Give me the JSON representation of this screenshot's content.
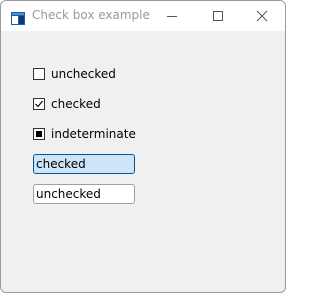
{
  "window": {
    "title": "Check box example",
    "colors": {
      "title_text": "#9a9a9a",
      "client_background": "#f0f0f0",
      "selected_textbox_background": "#cce4f7",
      "selected_textbox_border": "#005499"
    }
  },
  "title_bar": {
    "app_icon": "window-app-icon",
    "buttons": [
      {
        "name": "minimize",
        "icon": "minimize-icon"
      },
      {
        "name": "maximize",
        "icon": "maximize-icon"
      },
      {
        "name": "close",
        "icon": "close-icon"
      }
    ]
  },
  "checkboxes": [
    {
      "label": "unchecked",
      "state": "unchecked"
    },
    {
      "label": "checked",
      "state": "checked"
    },
    {
      "label": "indeterminate",
      "state": "indeterminate"
    }
  ],
  "textboxes": [
    {
      "value": "checked",
      "focused": true
    },
    {
      "value": "unchecked",
      "focused": false
    }
  ]
}
